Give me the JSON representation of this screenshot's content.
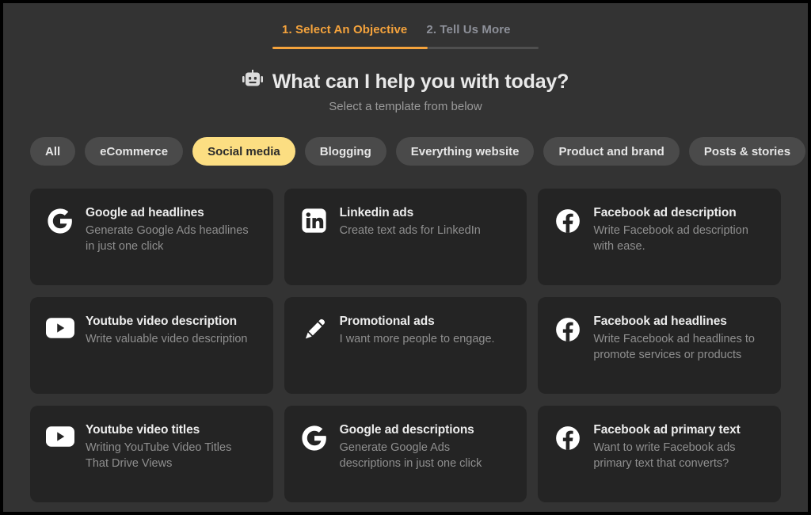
{
  "wizard": {
    "steps": [
      {
        "label": "1. Select An Objective",
        "state": "active"
      },
      {
        "label": "2. Tell Us More",
        "state": "inactive"
      }
    ]
  },
  "header": {
    "icon": "robot-icon",
    "title": "What can I help you with today?",
    "subtitle": "Select a template from below"
  },
  "filters": {
    "chips": [
      {
        "label": "All",
        "active": false
      },
      {
        "label": "eCommerce",
        "active": false
      },
      {
        "label": "Social media",
        "active": true
      },
      {
        "label": "Blogging",
        "active": false
      },
      {
        "label": "Everything website",
        "active": false
      },
      {
        "label": "Product and brand",
        "active": false
      },
      {
        "label": "Posts & stories",
        "active": false
      }
    ]
  },
  "templates": [
    {
      "icon": "google-icon",
      "title": "Google ad headlines",
      "description": "Generate Google Ads headlines in just one click"
    },
    {
      "icon": "linkedin-icon",
      "title": "Linkedin ads",
      "description": "Create text ads for LinkedIn"
    },
    {
      "icon": "facebook-icon",
      "title": "Facebook ad description",
      "description": "Write Facebook ad description with ease."
    },
    {
      "icon": "youtube-icon",
      "title": "Youtube video description",
      "description": "Write valuable video description"
    },
    {
      "icon": "pencil-icon",
      "title": "Promotional ads",
      "description": "I want more people to engage."
    },
    {
      "icon": "facebook-icon",
      "title": "Facebook ad headlines",
      "description": "Write Facebook ad headlines to promote services or products"
    },
    {
      "icon": "youtube-icon",
      "title": "Youtube video titles",
      "description": "Writing YouTube Video Titles That Drive Views"
    },
    {
      "icon": "google-icon",
      "title": "Google ad descriptions",
      "description": "Generate Google Ads descriptions in just one click"
    },
    {
      "icon": "facebook-icon",
      "title": "Facebook ad primary text",
      "description": "Want to write Facebook ads primary text that converts?"
    }
  ],
  "colors": {
    "page_background": "#333333",
    "card_background": "#242424",
    "accent": "#F5A33C",
    "chip_active": "#FCDE82",
    "chip_inactive": "#4A4A4A"
  }
}
